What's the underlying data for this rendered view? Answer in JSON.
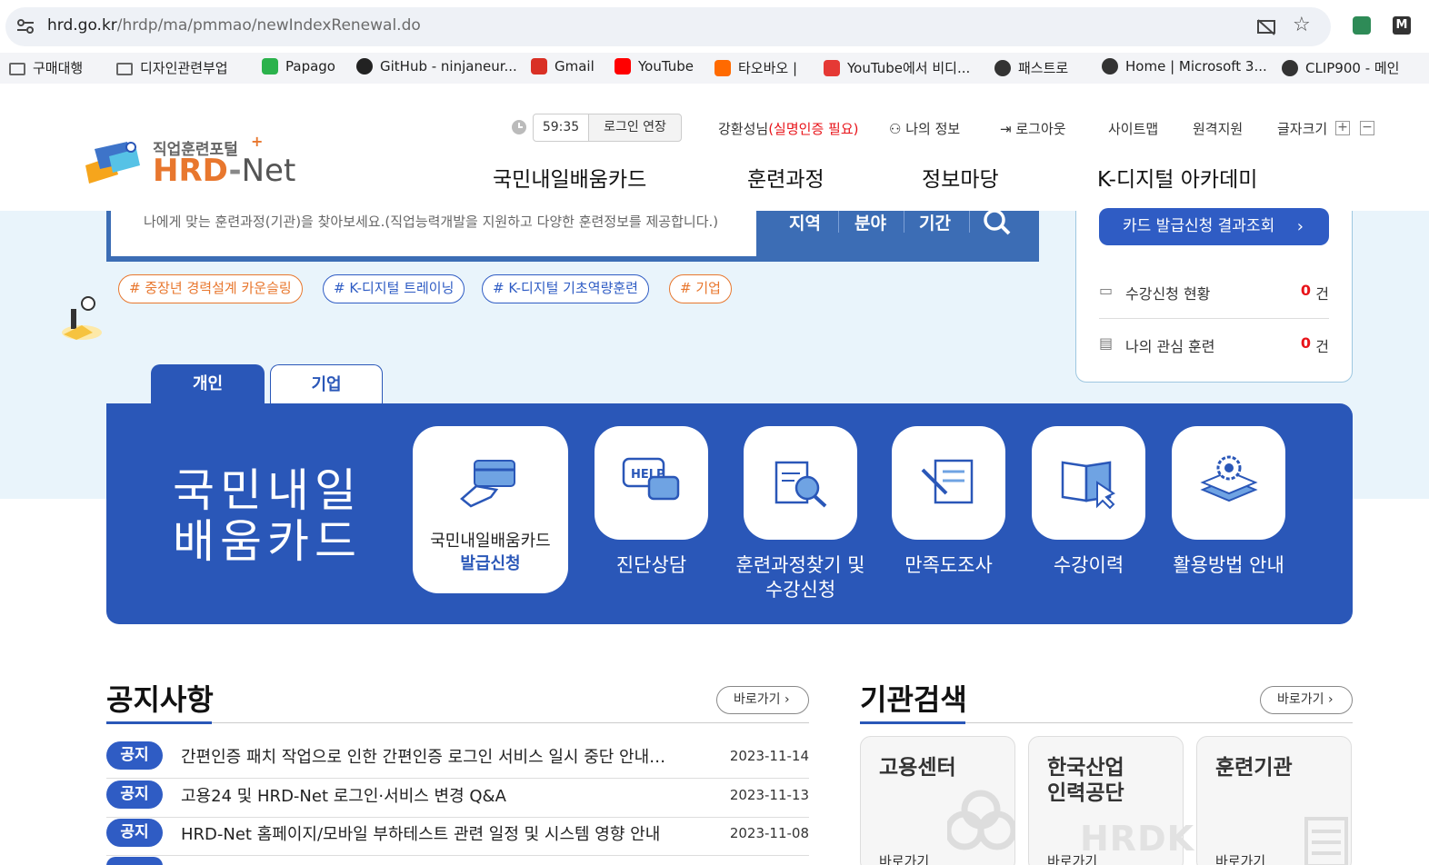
{
  "browser": {
    "url_host": "hrd.go.kr",
    "url_path": "/hrdp/ma/pmmao/newIndexRenewal.do",
    "bookmarks": [
      {
        "label": "구매대행",
        "icon": "folder-icon"
      },
      {
        "label": "디자인관련부업",
        "icon": "folder-icon"
      },
      {
        "label": "Papago",
        "icon": "papago-icon"
      },
      {
        "label": "GitHub - ninjaneur...",
        "icon": "github-icon"
      },
      {
        "label": "Gmail",
        "icon": "gmail-icon"
      },
      {
        "label": "YouTube",
        "icon": "youtube-icon"
      },
      {
        "label": "타오바오 |",
        "icon": "taobao-icon"
      },
      {
        "label": "YouTube에서 비디...",
        "icon": "download-icon"
      },
      {
        "label": "패스트로",
        "icon": "globe-icon"
      },
      {
        "label": "Home | Microsoft 3...",
        "icon": "globe-icon"
      },
      {
        "label": "CLIP900 - 메인",
        "icon": "globe-icon"
      }
    ]
  },
  "header": {
    "logo_small": "직업훈련포털",
    "logo_main_hrd": "HRD",
    "logo_main_dash": "-",
    "logo_main_net": "Net",
    "timer": "59:35",
    "extend_login": "로그인 연장",
    "user_name": "강환성님",
    "user_notice": "(실명인증 필요)",
    "my_info": "나의 정보",
    "logout": "로그아웃",
    "sitemap": "사이트맵",
    "remote": "원격지원",
    "font_size": "글자크기",
    "nav": [
      "국민내일배움카드",
      "훈련과정",
      "정보마당",
      "K-디지털 아카데미"
    ]
  },
  "search": {
    "placeholder": "나에게 맞는 훈련과정(기관)을 찾아보세요.(직업능력개발을 지원하고 다양한 훈련정보를 제공합니다.)",
    "filters": [
      "지역",
      "분야",
      "기간"
    ]
  },
  "hashtags": [
    {
      "label": "# 중장년 경력설계 카운슬링",
      "color": "#e8772e"
    },
    {
      "label": "# K-디지털 트레이닝",
      "color": "#2f5cc4"
    },
    {
      "label": "# K-디지털 기초역량훈련",
      "color": "#2f5cc4"
    },
    {
      "label": "# 기업",
      "color": "#e8772e"
    }
  ],
  "side_panel": {
    "card_button": "카드 발급신청 결과조회",
    "rows": [
      {
        "label": "수강신청 현황",
        "count": "0",
        "unit": "건"
      },
      {
        "label": "나의 관심 훈련",
        "count": "0",
        "unit": "건"
      }
    ]
  },
  "tabs": [
    "개인",
    "기업"
  ],
  "panel": {
    "title": "국민내일\n배움카드",
    "first_card_line1": "국민내일배움카드",
    "first_card_line2": "발급신청",
    "items": [
      "진단상담",
      "훈련과정찾기 및\n수강신청",
      "만족도조사",
      "수강이력",
      "활용방법 안내"
    ]
  },
  "notices": {
    "title": "공지사항",
    "more": "바로가기",
    "rows": [
      {
        "badge": "공지",
        "text": "간편인증 패치 작업으로 인한 간편인증 로그인 서비스 일시 중단 안내…",
        "date": "2023-11-14"
      },
      {
        "badge": "공지",
        "text": "고용24 및 HRD-Net 로그인·서비스 변경 Q&A",
        "date": "2023-11-13"
      },
      {
        "badge": "공지",
        "text": "HRD-Net 홈페이지/모바일 부하테스트 관련 일정 및 시스템 영향 안내",
        "date": "2023-11-08"
      }
    ]
  },
  "institutions": {
    "title": "기관검색",
    "more": "바로가기",
    "cards": [
      {
        "title": "고용센터",
        "link": "바로가기"
      },
      {
        "title": "한국산업\n인력공단",
        "link": "바로가기"
      },
      {
        "title": "훈련기관",
        "link": "바로가기"
      }
    ]
  },
  "colors": {
    "primary": "#2a57b8",
    "accent_orange": "#e8772e",
    "alert_red": "#e8141a",
    "hero_bg": "#e9f4fb"
  }
}
